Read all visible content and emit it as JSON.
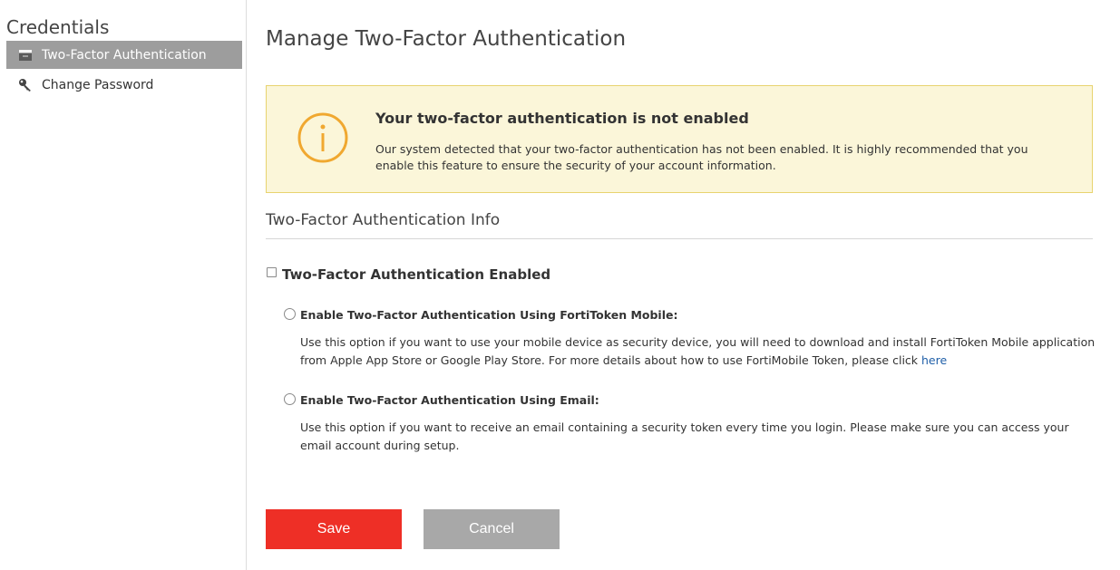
{
  "sidebar": {
    "title": "Credentials",
    "items": [
      {
        "label": "Two-Factor Authentication",
        "icon": "inbox-icon",
        "active": true
      },
      {
        "label": "Change Password",
        "icon": "key-icon",
        "active": false
      }
    ]
  },
  "main": {
    "title": "Manage Two-Factor Authentication",
    "alert": {
      "icon": "info-icon",
      "heading": "Your two-factor authentication is not enabled",
      "body": "Our system detected that your two-factor authentication has not been enabled. It is highly recommended that you enable this feature to ensure the security of your account information."
    },
    "section_title": "Two-Factor Authentication Info",
    "enabled_checkbox": {
      "label": "Two-Factor Authentication Enabled",
      "checked": false
    },
    "options": [
      {
        "title": "Enable Two-Factor Authentication Using FortiToken Mobile:",
        "description": "Use this option if you want to use your mobile device as security device, you will need to download and install FortiToken Mobile application from Apple App Store or Google Play Store. For more details about how to use FortiMobile Token, please click ",
        "link_text": "here",
        "selected": false
      },
      {
        "title": "Enable Two-Factor Authentication Using Email:",
        "description": "Use this option if you want to receive an email containing a security token every time you login. Please make sure you can access your email account during setup.",
        "selected": false
      }
    ],
    "buttons": {
      "save": "Save",
      "cancel": "Cancel"
    }
  },
  "colors": {
    "save": "#ee2f26",
    "cancel": "#a8a8a8",
    "alert_bg": "#fbf6d9",
    "alert_border": "#e8d36f",
    "alert_icon": "#f0a830",
    "active_nav": "#9d9d9d",
    "link": "#1f5fa8"
  }
}
